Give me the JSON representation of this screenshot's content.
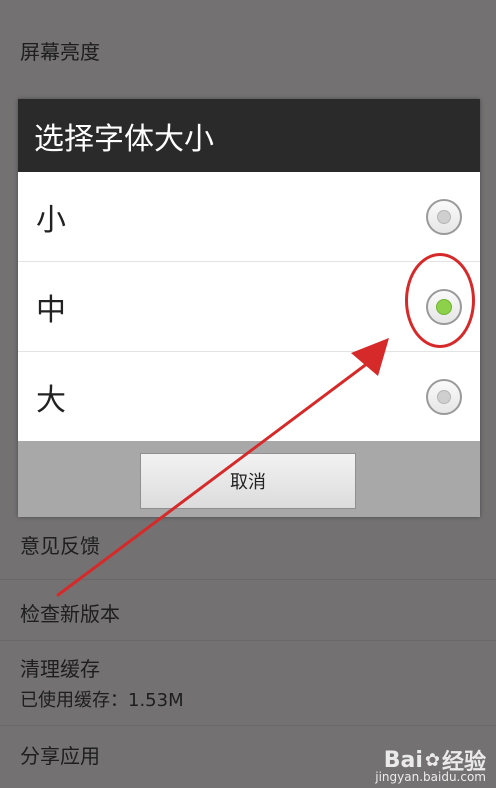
{
  "background": {
    "items": {
      "brightness": "屏幕亮度",
      "feedback": "意见反馈",
      "check_update": "检查新版本",
      "clear_cache": "清理缓存",
      "cache_used": "已使用缓存：1.53M",
      "share_app": "分享应用"
    }
  },
  "dialog": {
    "title": "选择字体大小",
    "options": [
      {
        "label": "小",
        "checked": false
      },
      {
        "label": "中",
        "checked": true
      },
      {
        "label": "大",
        "checked": false
      }
    ],
    "cancel_label": "取消"
  },
  "annotation": {
    "color": "#d62a2a"
  },
  "watermark": {
    "brand": "Bai",
    "brand2": "经验",
    "site": "jingyan.baidu.com"
  }
}
